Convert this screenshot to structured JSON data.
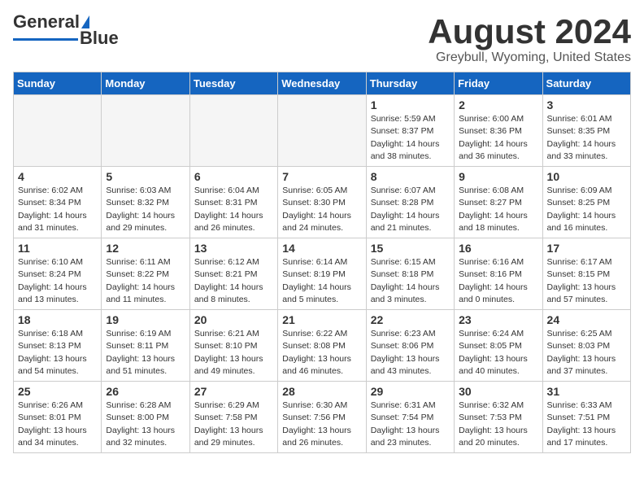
{
  "header": {
    "logo_general": "General",
    "logo_blue": "Blue",
    "month": "August 2024",
    "location": "Greybull, Wyoming, United States"
  },
  "weekdays": [
    "Sunday",
    "Monday",
    "Tuesday",
    "Wednesday",
    "Thursday",
    "Friday",
    "Saturday"
  ],
  "weeks": [
    [
      {
        "day": "",
        "info": ""
      },
      {
        "day": "",
        "info": ""
      },
      {
        "day": "",
        "info": ""
      },
      {
        "day": "",
        "info": ""
      },
      {
        "day": "1",
        "info": "Sunrise: 5:59 AM\nSunset: 8:37 PM\nDaylight: 14 hours\nand 38 minutes."
      },
      {
        "day": "2",
        "info": "Sunrise: 6:00 AM\nSunset: 8:36 PM\nDaylight: 14 hours\nand 36 minutes."
      },
      {
        "day": "3",
        "info": "Sunrise: 6:01 AM\nSunset: 8:35 PM\nDaylight: 14 hours\nand 33 minutes."
      }
    ],
    [
      {
        "day": "4",
        "info": "Sunrise: 6:02 AM\nSunset: 8:34 PM\nDaylight: 14 hours\nand 31 minutes."
      },
      {
        "day": "5",
        "info": "Sunrise: 6:03 AM\nSunset: 8:32 PM\nDaylight: 14 hours\nand 29 minutes."
      },
      {
        "day": "6",
        "info": "Sunrise: 6:04 AM\nSunset: 8:31 PM\nDaylight: 14 hours\nand 26 minutes."
      },
      {
        "day": "7",
        "info": "Sunrise: 6:05 AM\nSunset: 8:30 PM\nDaylight: 14 hours\nand 24 minutes."
      },
      {
        "day": "8",
        "info": "Sunrise: 6:07 AM\nSunset: 8:28 PM\nDaylight: 14 hours\nand 21 minutes."
      },
      {
        "day": "9",
        "info": "Sunrise: 6:08 AM\nSunset: 8:27 PM\nDaylight: 14 hours\nand 18 minutes."
      },
      {
        "day": "10",
        "info": "Sunrise: 6:09 AM\nSunset: 8:25 PM\nDaylight: 14 hours\nand 16 minutes."
      }
    ],
    [
      {
        "day": "11",
        "info": "Sunrise: 6:10 AM\nSunset: 8:24 PM\nDaylight: 14 hours\nand 13 minutes."
      },
      {
        "day": "12",
        "info": "Sunrise: 6:11 AM\nSunset: 8:22 PM\nDaylight: 14 hours\nand 11 minutes."
      },
      {
        "day": "13",
        "info": "Sunrise: 6:12 AM\nSunset: 8:21 PM\nDaylight: 14 hours\nand 8 minutes."
      },
      {
        "day": "14",
        "info": "Sunrise: 6:14 AM\nSunset: 8:19 PM\nDaylight: 14 hours\nand 5 minutes."
      },
      {
        "day": "15",
        "info": "Sunrise: 6:15 AM\nSunset: 8:18 PM\nDaylight: 14 hours\nand 3 minutes."
      },
      {
        "day": "16",
        "info": "Sunrise: 6:16 AM\nSunset: 8:16 PM\nDaylight: 14 hours\nand 0 minutes."
      },
      {
        "day": "17",
        "info": "Sunrise: 6:17 AM\nSunset: 8:15 PM\nDaylight: 13 hours\nand 57 minutes."
      }
    ],
    [
      {
        "day": "18",
        "info": "Sunrise: 6:18 AM\nSunset: 8:13 PM\nDaylight: 13 hours\nand 54 minutes."
      },
      {
        "day": "19",
        "info": "Sunrise: 6:19 AM\nSunset: 8:11 PM\nDaylight: 13 hours\nand 51 minutes."
      },
      {
        "day": "20",
        "info": "Sunrise: 6:21 AM\nSunset: 8:10 PM\nDaylight: 13 hours\nand 49 minutes."
      },
      {
        "day": "21",
        "info": "Sunrise: 6:22 AM\nSunset: 8:08 PM\nDaylight: 13 hours\nand 46 minutes."
      },
      {
        "day": "22",
        "info": "Sunrise: 6:23 AM\nSunset: 8:06 PM\nDaylight: 13 hours\nand 43 minutes."
      },
      {
        "day": "23",
        "info": "Sunrise: 6:24 AM\nSunset: 8:05 PM\nDaylight: 13 hours\nand 40 minutes."
      },
      {
        "day": "24",
        "info": "Sunrise: 6:25 AM\nSunset: 8:03 PM\nDaylight: 13 hours\nand 37 minutes."
      }
    ],
    [
      {
        "day": "25",
        "info": "Sunrise: 6:26 AM\nSunset: 8:01 PM\nDaylight: 13 hours\nand 34 minutes."
      },
      {
        "day": "26",
        "info": "Sunrise: 6:28 AM\nSunset: 8:00 PM\nDaylight: 13 hours\nand 32 minutes."
      },
      {
        "day": "27",
        "info": "Sunrise: 6:29 AM\nSunset: 7:58 PM\nDaylight: 13 hours\nand 29 minutes."
      },
      {
        "day": "28",
        "info": "Sunrise: 6:30 AM\nSunset: 7:56 PM\nDaylight: 13 hours\nand 26 minutes."
      },
      {
        "day": "29",
        "info": "Sunrise: 6:31 AM\nSunset: 7:54 PM\nDaylight: 13 hours\nand 23 minutes."
      },
      {
        "day": "30",
        "info": "Sunrise: 6:32 AM\nSunset: 7:53 PM\nDaylight: 13 hours\nand 20 minutes."
      },
      {
        "day": "31",
        "info": "Sunrise: 6:33 AM\nSunset: 7:51 PM\nDaylight: 13 hours\nand 17 minutes."
      }
    ]
  ]
}
